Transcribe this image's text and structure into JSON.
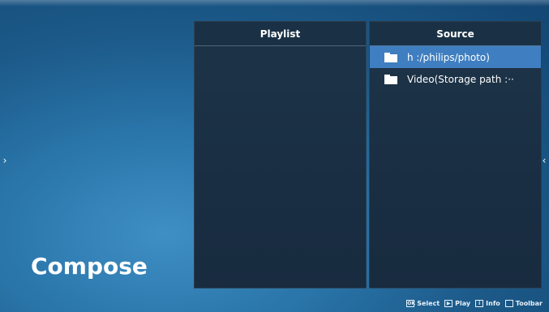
{
  "left_nav_arrow": "›",
  "right_nav_arrow": "‹",
  "title": "Compose",
  "playlist": {
    "header": "Playlist",
    "items": []
  },
  "source": {
    "header": "Source",
    "items": [
      {
        "label": "h :/philips/photo)",
        "icon": "folder-icon",
        "selected": true
      },
      {
        "label": "Video(Storage path :··",
        "icon": "folder-icon",
        "selected": false
      }
    ]
  },
  "footer": {
    "hints": [
      {
        "icon": "ok-icon",
        "icon_text": "OK",
        "label": "Select"
      },
      {
        "icon": "play-icon",
        "icon_text": "▶",
        "label": "Play"
      },
      {
        "icon": "info-icon",
        "icon_text": "i",
        "label": "Info"
      },
      {
        "icon": "toolbar-icon",
        "icon_text": "",
        "label": "Toolbar"
      }
    ]
  },
  "colors": {
    "selected_row": "#3f7ec0",
    "panel_bg": "#1a2f44",
    "background": "#2a76ab"
  }
}
